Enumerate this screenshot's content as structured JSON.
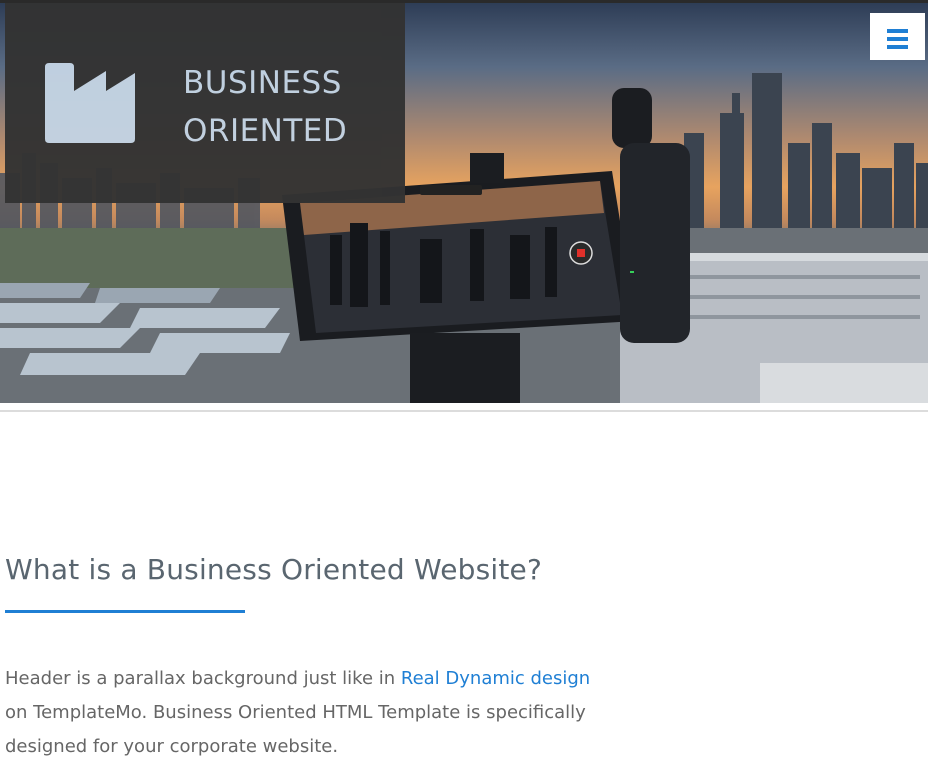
{
  "brand": {
    "line1": "BUSINESS",
    "line2": "ORIENTED",
    "icon": "factory-icon"
  },
  "header": {
    "menu_icon": "hamburger-menu-icon",
    "accent_color": "#1f7fd4"
  },
  "section": {
    "heading": "What is a Business Oriented Website?",
    "paragraph_before": "Header is a parallax background just like in ",
    "link_text": "Real Dynamic design",
    "paragraph_after": " on TemplateMo. Business Oriented HTML Template is specifically designed for your corporate website."
  }
}
